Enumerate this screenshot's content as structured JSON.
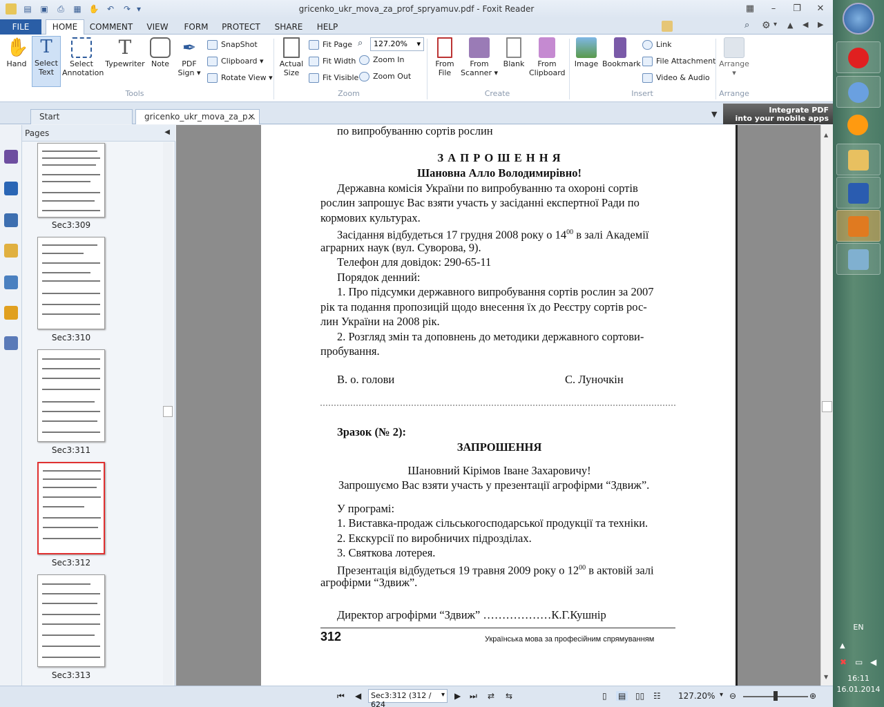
{
  "window": {
    "title": "gricenko_ukr_mova_za_prof_spryamuv.pdf - Foxit Reader"
  },
  "ribbon_tabs": [
    "FILE",
    "HOME",
    "COMMENT",
    "VIEW",
    "FORM",
    "PROTECT",
    "SHARE",
    "HELP"
  ],
  "find": {
    "placeholder": "Find"
  },
  "tools": {
    "hand": "Hand",
    "select_text_1": "Select",
    "select_text_2": "Text",
    "select_annot_1": "Select",
    "select_annot_2": "Annotation",
    "typewriter": "Typewriter",
    "note": "Note",
    "pdf_sign_1": "PDF",
    "pdf_sign_2": "Sign",
    "snapshot": "SnapShot",
    "clipboard": "Clipboard",
    "rotate": "Rotate View",
    "group": "Tools"
  },
  "zoom": {
    "actual_1": "Actual",
    "actual_2": "Size",
    "fit_page": "Fit Page",
    "fit_width": "Fit Width",
    "fit_visible": "Fit Visible",
    "value": "127.20%",
    "zoom_in": "Zoom In",
    "zoom_out": "Zoom Out",
    "group": "Zoom"
  },
  "create": {
    "from_file_1": "From",
    "from_file_2": "File",
    "scanner_1": "From",
    "scanner_2": "Scanner",
    "blank": "Blank",
    "clip_1": "From",
    "clip_2": "Clipboard",
    "group": "Create"
  },
  "insert": {
    "image": "Image",
    "bookmark": "Bookmark",
    "link": "Link",
    "file_attachment": "File Attachment",
    "video_audio": "Video & Audio",
    "group": "Insert"
  },
  "arrange": {
    "label": "Arrange",
    "group": "Arrange"
  },
  "doc_tabs": [
    "Start",
    "gricenko_ukr_mova_za_p..."
  ],
  "promo": {
    "line1": "Integrate PDF",
    "line2": "into your mobile apps"
  },
  "pages_panel": {
    "title": "Pages",
    "thumbs": [
      "Sec3:309",
      "Sec3:310",
      "Sec3:311",
      "Sec3:312",
      "Sec3:313"
    ]
  },
  "document": {
    "top_line": "по випробуванню сортів рослин",
    "h1": "З А П Р О Ш Е Н Н Я",
    "h1_sub": "Шановна Алло Володимирівно!",
    "p1_a": "Державна комісія України по випробуванню та охороні сортів",
    "p1_b": "рослин запрошує Вас взяти участь у засіданні експертної Ради по",
    "p1_c": "кормових культурах.",
    "p2_a": "Засідання відбудеться 17 грудня 2008 року о 14",
    "p2_sup": "00",
    "p2_a2": " в залі Академії",
    "p2_b": "аграрних наук (вул. Суворова, 9).",
    "phone": "Телефон для довідок: 290-65-11",
    "agenda": "Порядок денний:",
    "a1_a": "1. Про підсумки державного випробування сортів рослин за 2007",
    "a1_b": "рік та подання пропозицій щодо внесення їх до Реєстру сортів рос-",
    "a1_c": "лин України на 2008 рік.",
    "a2_a": "2. Розгляд змін та доповнень до методики державного сортови-",
    "a2_b": "пробування.",
    "sign_left": "В. о. голови",
    "sign_right": "С. Луночкін",
    "sample": "Зразок (№ 2):",
    "h2": "ЗАПРОШЕННЯ",
    "greet": "Шановний Кірімов Іване Захаровичу!",
    "invite": "Запрошуємо Вас взяти участь у презентації агрофірми “Здвиж”.",
    "program": "У програмі:",
    "i1": "1. Виставка-продаж сільськогосподарської продукції та техніки.",
    "i2": "2. Екскурсії по виробничих підрозділах.",
    "i3": "3. Святкова лотерея.",
    "pres_a": "Презентація відбудеться 19 травня 2009 року о 12",
    "pres_sup": "00",
    "pres_a2": " в актовій залі",
    "pres_b": "агрофірми “Здвиж”.",
    "director": "Директор агрофірми “Здвиж” ………………К.Г.Кушнір",
    "page_num": "312",
    "footer": "Українська мова за професійним спрямуванням"
  },
  "status": {
    "page": "Sec3:312 (312 / 624",
    "zoom": "127.20%"
  },
  "taskbar": {
    "lang": "EN",
    "time": "16:11",
    "date": "16.01.2014"
  }
}
